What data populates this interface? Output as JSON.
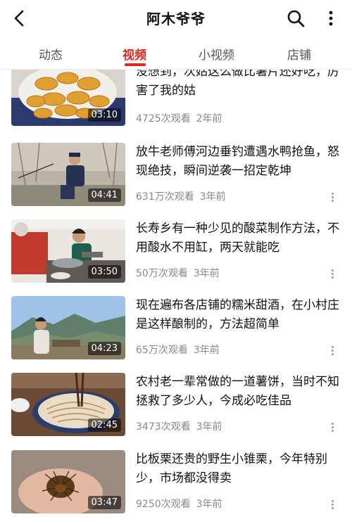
{
  "header": {
    "title": "阿木爷爷",
    "back_icon": "chevron-left-icon",
    "search_icon": "search-icon",
    "more_icon": "more-vertical-icon"
  },
  "tabs": [
    {
      "label": "动态",
      "active": false
    },
    {
      "label": "视频",
      "active": true
    },
    {
      "label": "小视频",
      "active": false
    },
    {
      "label": "店铺",
      "active": false
    }
  ],
  "colors": {
    "accent": "#e0291d",
    "meta": "#888888"
  },
  "videos": [
    {
      "title": "没想到，次姑这么做比薯片还好吃，厉害了我的姑",
      "duration": "03:10",
      "views": "4725次观看",
      "age": "2年前"
    },
    {
      "title": "放牛老师傅河边垂钓遭遇水鸭抢鱼，怒现绝技，瞬间逆袭一招定乾坤",
      "duration": "04:41",
      "views": "631万次观看",
      "age": "3年前"
    },
    {
      "title": "长寿乡有一种少见的酸菜制作方法，不用酸水不用缸，两天就能吃",
      "duration": "03:50",
      "views": "50万次观看",
      "age": "3年前"
    },
    {
      "title": "现在遍布各店铺的糯米甜酒，在小村庄是这样酿制的，方法超简单",
      "duration": "04:23",
      "views": "65万次观看",
      "age": "3年前"
    },
    {
      "title": "农村老一辈常做的一道薯饼，当时不知拯救了多少人，今成必吃佳品",
      "duration": "02:45",
      "views": "3473次观看",
      "age": "3年前"
    },
    {
      "title": "比板栗还贵的野生小锥栗，今年特别少，市场都没得卖",
      "duration": "03:47",
      "views": "9250次观看",
      "age": "3年前"
    }
  ]
}
